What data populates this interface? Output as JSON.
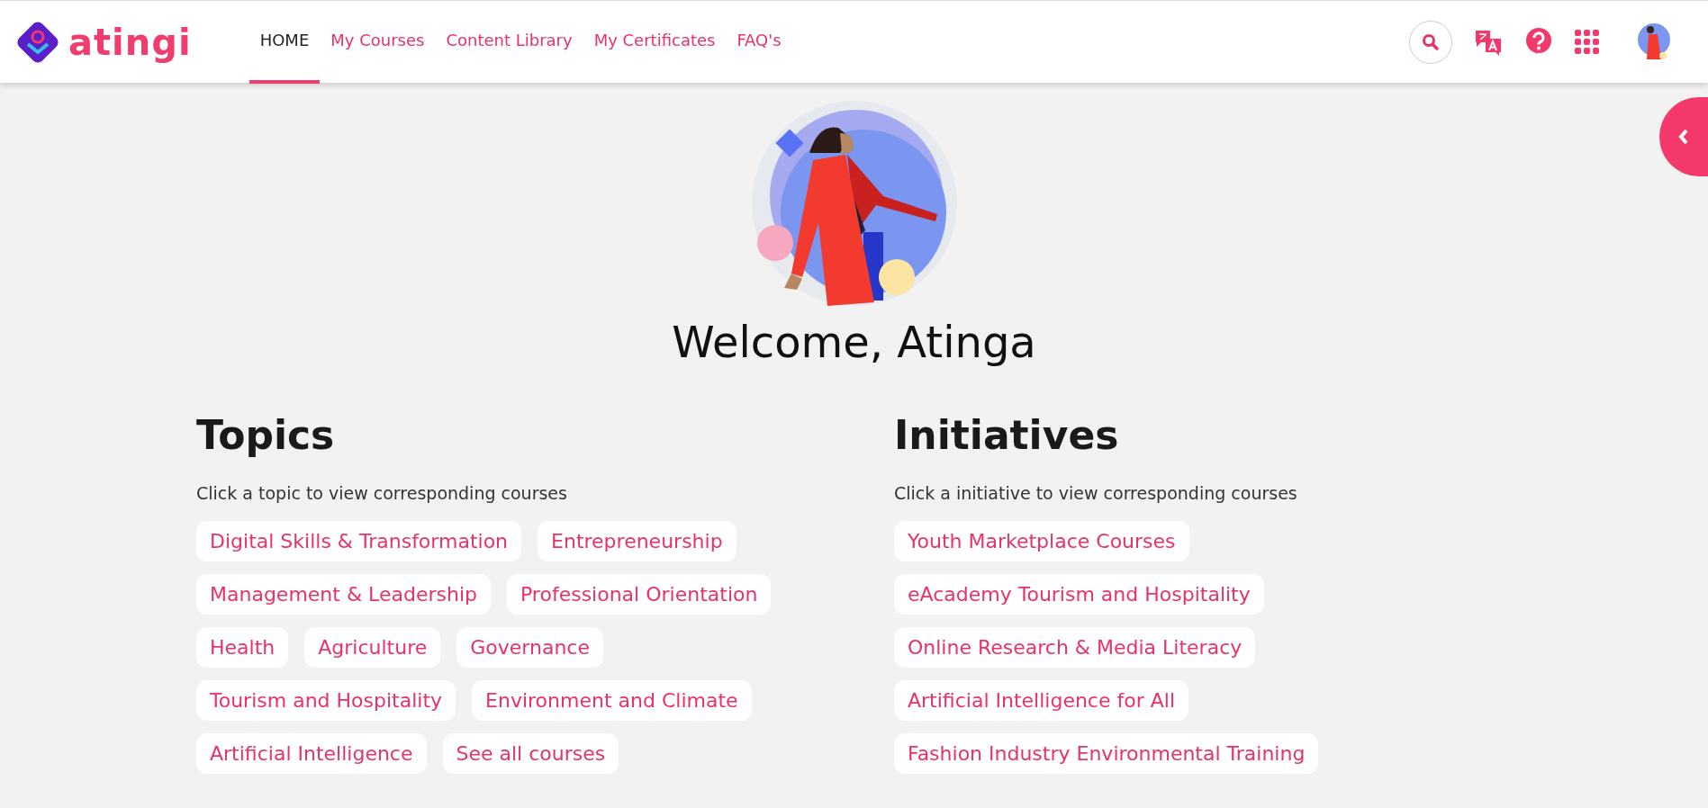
{
  "brand": {
    "name": "atingi"
  },
  "nav": [
    {
      "label": "HOME",
      "selected": true
    },
    {
      "label": "My Courses",
      "selected": false
    },
    {
      "label": "Content Library",
      "selected": false
    },
    {
      "label": "My Certificates",
      "selected": false
    },
    {
      "label": "FAQ's",
      "selected": false
    }
  ],
  "welcome": "Welcome, Atinga",
  "sections": [
    {
      "title": "Topics",
      "subtitle": "Click a topic to view corresponding courses",
      "chips": [
        "Digital Skills & Transformation",
        "Entrepreneurship",
        "Management & Leadership",
        "Professional Orientation",
        "Health",
        "Agriculture",
        "Governance",
        "Tourism and Hospitality",
        "Environment and Climate",
        "Artificial Intelligence",
        "See all courses"
      ]
    },
    {
      "title": "Initiatives",
      "subtitle": "Click a initiative to view corresponding courses",
      "chips": [
        "Youth Marketplace Courses",
        "eAcademy Tourism and Hospitality",
        "Online Research & Media Literacy",
        "Artificial Intelligence for All",
        "Fashion Industry Environmental Training"
      ]
    }
  ]
}
